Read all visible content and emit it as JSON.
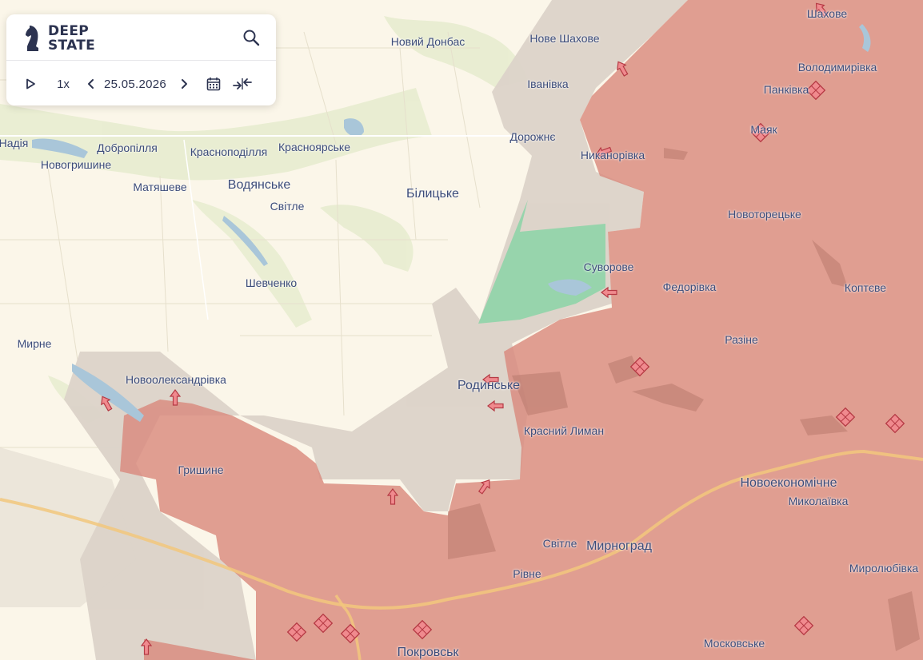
{
  "app": {
    "brand_line1": "DEEP",
    "brand_line2": "STATE",
    "logo_icon": "knight-chess-icon"
  },
  "toolbar": {
    "search_icon": "search-icon",
    "play_icon": "play-icon",
    "speed": "1x",
    "prev_icon": "chevron-left-icon",
    "date": "25.05.2026",
    "next_icon": "chevron-right-icon",
    "calendar_icon": "calendar-icon",
    "compare_icon": "compare-arrows-icon"
  },
  "colors": {
    "background": "#fbf6e9",
    "occupied": "#d98a7e",
    "grey_zone": "#dcd3c9",
    "liberated": "#8fd4a8",
    "water": "#a9c6d9",
    "marker": "#e0656a",
    "place_text": "#3c4c7a"
  },
  "places": {
    "novyi_donbas": "Новий Донбас",
    "nove_shakhove": "Нове Шахове",
    "shakhove": "Шахове",
    "ivanivka": "Іванівка",
    "volodymyrivka": "Володимирівка",
    "pankivka": "Панківка",
    "nadiia": "Надія",
    "dobropillia": "Добропілля",
    "krasnopodillia": "Красноподілля",
    "krasnoiarske": "Красноярське",
    "dorozhnie": "Дорожнє",
    "maiak": "Маяк",
    "novohryshyne": "Новогришине",
    "nykanorivka": "Никанорівка",
    "matiasheve": "Матяшеве",
    "vodianske": "Водянське",
    "bilytske": "Білицьке",
    "svitle_north": "Світле",
    "novotoretske": "Новоторецьке",
    "suvorove": "Суворове",
    "shevchenko": "Шевченко",
    "fedorivka": "Федорівка",
    "koptieve": "Коптєве",
    "myrne": "Мирне",
    "razine": "Разіне",
    "novooleksandrivka": "Новоолександрівка",
    "rodynske": "Родинське",
    "krasnyi_lyman": "Красний Лиман",
    "hryshyne": "Гришине",
    "novoekonomichne": "Новоекономічне",
    "mykolaivka": "Миколаївка",
    "svitle_south": "Світле",
    "myrnohrad": "Мирноград",
    "rivne": "Рівне",
    "myroliubivka": "Миролюбівка",
    "moskovske": "Московське",
    "pokrovsk": "Покровськ"
  }
}
